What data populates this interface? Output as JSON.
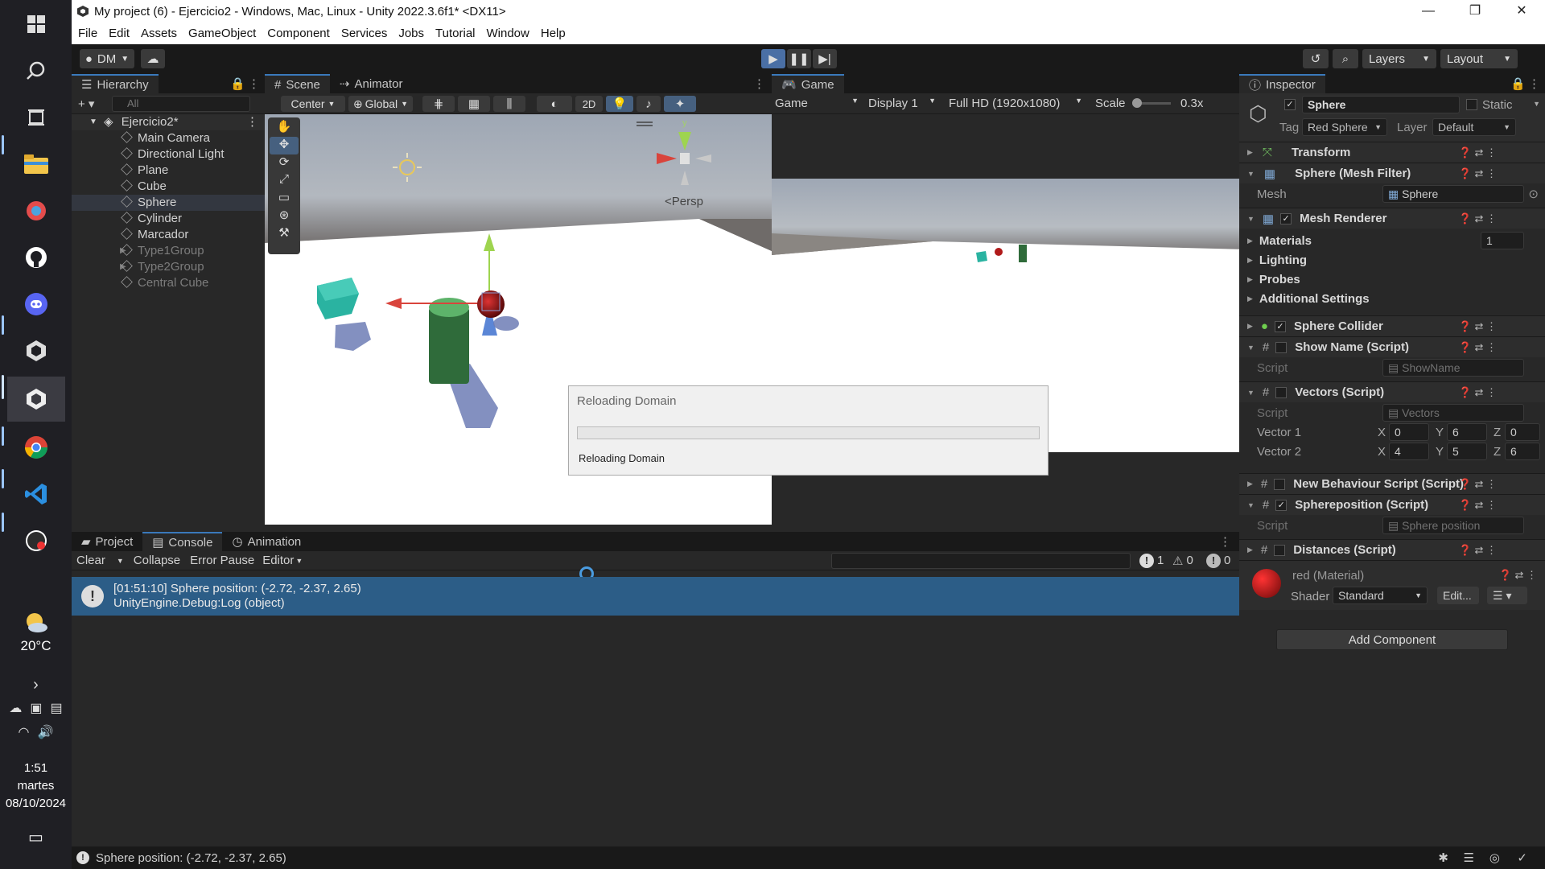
{
  "window": {
    "title": "My project (6) - Ejercicio2 - Windows, Mac, Linux - Unity 2022.3.6f1* <DX11>",
    "minimize": "—",
    "maximize": "❐",
    "close": "✕"
  },
  "menu": [
    "File",
    "Edit",
    "Assets",
    "GameObject",
    "Component",
    "Services",
    "Jobs",
    "Tutorial",
    "Window",
    "Help"
  ],
  "toolbar": {
    "account": "DM",
    "layers": "Layers",
    "layout": "Layout"
  },
  "hierarchy": {
    "tab": "Hierarchy",
    "search_placeholder": "All",
    "root": "Ejercicio2*",
    "items": [
      {
        "label": "Main Camera"
      },
      {
        "label": "Directional Light"
      },
      {
        "label": "Plane"
      },
      {
        "label": "Cube"
      },
      {
        "label": "Sphere"
      },
      {
        "label": "Cylinder"
      },
      {
        "label": "Marcador"
      },
      {
        "label": "Type1Group"
      },
      {
        "label": "Type2Group"
      },
      {
        "label": "Central Cube"
      }
    ]
  },
  "scene": {
    "tabs": [
      "Scene",
      "Animator"
    ],
    "pivot": "Center",
    "space": "Global",
    "mode_2d": "2D",
    "persp": "<Persp",
    "gizmo_y": "y"
  },
  "game": {
    "tab": "Game",
    "view": "Game",
    "display": "Display 1",
    "resolution": "Full HD (1920x1080)",
    "scale_label": "Scale",
    "scale_value": "0.3x"
  },
  "dialog": {
    "title": "Reloading Domain",
    "message": "Reloading Domain",
    "progress": 0
  },
  "inspector": {
    "tab": "Inspector",
    "object_name": "Sphere",
    "static_label": "Static",
    "tag_label": "Tag",
    "tag_value": "Red Sphere",
    "layer_label": "Layer",
    "layer_value": "Default",
    "transform": "Transform",
    "mesh_filter": "Sphere (Mesh Filter)",
    "mesh_label": "Mesh",
    "mesh_value": "Sphere",
    "mesh_renderer": "Mesh Renderer",
    "materials": "Materials",
    "materials_count": "1",
    "lighting": "Lighting",
    "probes": "Probes",
    "additional": "Additional Settings",
    "sphere_collider": "Sphere Collider",
    "show_name": "Show Name (Script)",
    "script_label": "Script",
    "show_name_script": "ShowName",
    "vectors": "Vectors (Script)",
    "vectors_script": "Vectors",
    "vector1_label": "Vector 1",
    "vector2_label": "Vector 2",
    "axis_x": "X",
    "axis_y": "Y",
    "axis_z": "Z",
    "vector1": {
      "x": "0",
      "y": "6",
      "z": "0"
    },
    "vector2": {
      "x": "4",
      "y": "5",
      "z": "6"
    },
    "new_behaviour": "New Behaviour Script (Script)",
    "spherepos": "Sphereposition (Script)",
    "spherepos_script": "Sphere position",
    "distances": "Distances (Script)",
    "material_name": "red (Material)",
    "shader_label": "Shader",
    "shader_value": "Standard",
    "edit_label": "Edit...",
    "add_component": "Add Component"
  },
  "console": {
    "tabs": [
      "Project",
      "Console",
      "Animation"
    ],
    "clear": "Clear",
    "collapse": "Collapse",
    "error_pause": "Error Pause",
    "editor": "Editor",
    "count_info": "1",
    "count_warn": "0",
    "count_error": "0",
    "log_line1": "[01:51:10] Sphere position: (-2.72, -2.37, 2.65)",
    "log_line2": "UnityEngine.Debug:Log (object)"
  },
  "statusbar": {
    "message": "Sphere position: (-2.72, -2.37, 2.65)"
  },
  "taskbar": {
    "temperature": "20°C",
    "time": "1:51",
    "day": "martes",
    "date": "08/10/2024"
  }
}
